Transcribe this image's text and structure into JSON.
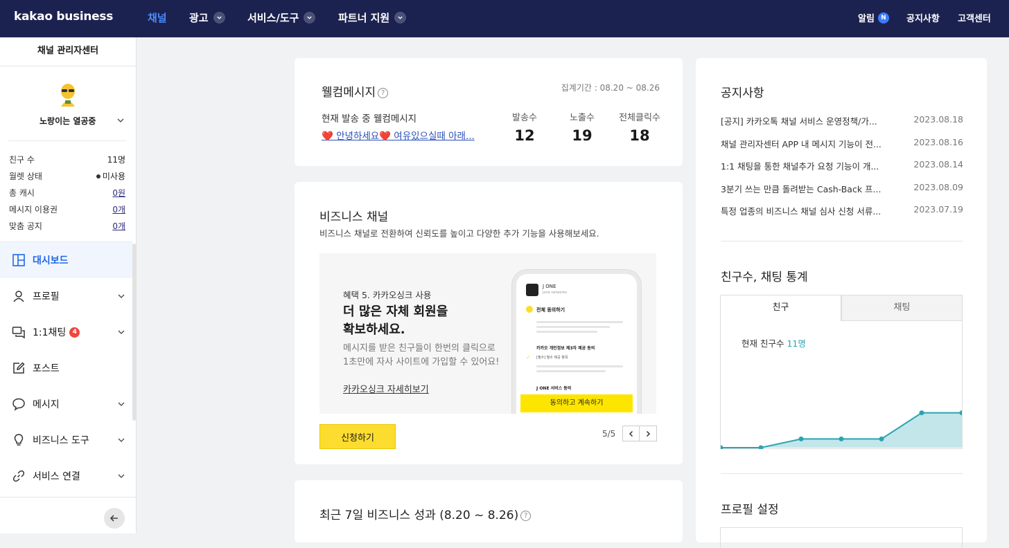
{
  "topnav": {
    "logo": "kakao business",
    "items": [
      {
        "label": "채널"
      },
      {
        "label": "광고"
      },
      {
        "label": "서비스/도구"
      },
      {
        "label": "파트너 지원"
      }
    ],
    "right": {
      "alert": "알림",
      "alert_badge": "N",
      "notice": "공지사항",
      "support": "고객센터"
    }
  },
  "sidebar": {
    "title": "채널 관리자센터",
    "profile_name": "노랑이는 열공중",
    "stats": [
      {
        "label": "친구 수",
        "value": "11명"
      },
      {
        "label": "월렛 상태",
        "value": "미사용"
      },
      {
        "label": "총 캐시",
        "value": "0원"
      },
      {
        "label": "메시지 이용권",
        "value": "0개"
      },
      {
        "label": "맞춤 공지",
        "value": "0개"
      }
    ],
    "menu": [
      {
        "label": "대시보드"
      },
      {
        "label": "프로필"
      },
      {
        "label": "1:1채팅",
        "badge": "4"
      },
      {
        "label": "포스트"
      },
      {
        "label": "메시지"
      },
      {
        "label": "비즈니스 도구"
      },
      {
        "label": "서비스 연결"
      }
    ]
  },
  "welcome": {
    "title": "웰컴메시지",
    "period": "집계기간 : 08.20 ~ 08.26",
    "current_label": "현재 발송 중 웰컴메시지",
    "message_link": "❤️ 안녕하세요❤️  여유있으실때 아래...",
    "metrics": [
      {
        "label": "발송수",
        "value": "12"
      },
      {
        "label": "노출수",
        "value": "19"
      },
      {
        "label": "전체클릭수",
        "value": "18"
      }
    ]
  },
  "biz_channel": {
    "title": "비즈니스 채널",
    "subtitle": "비즈니스 채널로 전환하여 신뢰도를 높이고 다양한 추가 기능을 사용해보세요.",
    "benefit": "혜택 5. 카카오싱크 사용",
    "headline1": "더 많은 자체 회원을",
    "headline2": "확보하세요.",
    "desc1": "메시지를 받은 친구들이 한번의 클릭으로",
    "desc2": "1초만에 자사 사이트에 가입할 수 있어요!",
    "detail_link": "카카오싱크 자세히보기",
    "apply_button": "신청하기",
    "pager": "5/5",
    "phone": {
      "brand": "J ONE",
      "brand_sub": "Jone networks",
      "agree_all": "전체 동의하기",
      "item1": "카카오 개인정보 제3자 제공 동의",
      "item1_sub": "[필수] 필수 제공 항목",
      "item2": "J ONE 서비스 동의",
      "cta": "동의하고 계속하기"
    }
  },
  "performance": {
    "title": "최근 7일 비즈니스 성과 (8.20 ~ 8.26)"
  },
  "notices": {
    "title": "공지사항",
    "items": [
      {
        "title": "[공지] 카카오톡 채널 서비스 운영정책/가...",
        "date": "2023.08.18"
      },
      {
        "title": "채널 관리자센터 APP 내 메시지 기능이 전...",
        "date": "2023.08.16"
      },
      {
        "title": "1:1 채팅을 통한 채널추가 요청 기능이 개...",
        "date": "2023.08.14"
      },
      {
        "title": "3분기 쓰는 만큼 돌려받는 Cash-Back 프...",
        "date": "2023.08.09"
      },
      {
        "title": "특정 업종의 비즈니스 채널 심사 신청 서류...",
        "date": "2023.07.19"
      }
    ]
  },
  "friend_stats": {
    "title": "친구수, 채팅 통계",
    "tabs": [
      "친구",
      "채팅"
    ],
    "current_label": "현재 친구수",
    "current_value": "11명"
  },
  "profile_settings": {
    "title": "프로필 설정"
  },
  "chart_data": {
    "type": "area",
    "title": "",
    "series": [
      {
        "values": [
          9,
          9,
          9.5,
          9.5,
          9.5,
          11,
          11
        ]
      }
    ],
    "ylim": [
      9,
      11.5
    ],
    "accent": "#2ba3b0"
  },
  "colors": {
    "nav_bg": "#1c2250",
    "active_blue": "#2067e6",
    "yellow": "#fcdc2f",
    "badge_red": "#f0463c"
  }
}
